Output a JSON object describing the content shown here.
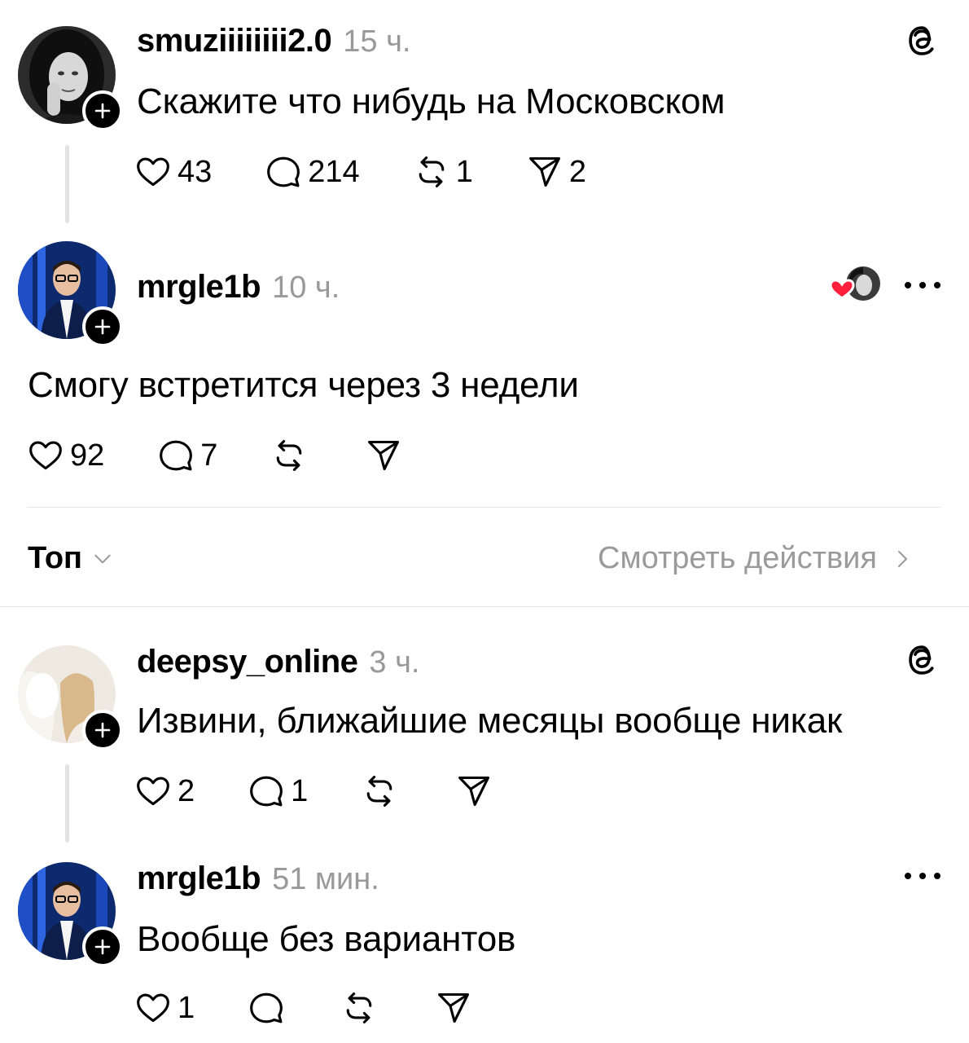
{
  "posts": [
    {
      "username": "smuziiiiiiii2.0",
      "time": "15 ч.",
      "text": "Скажите что нибудь на Московском",
      "likes": "43",
      "replies": "214",
      "reposts": "1",
      "shares": "2"
    },
    {
      "username": "mrgle1b",
      "time": "10 ч.",
      "text": "Смогу встретится через 3 недели",
      "likes": "92",
      "replies": "7"
    },
    {
      "username": "deepsy_online",
      "time": "3 ч.",
      "text": "Извини, ближайшие месяцы вообще никак",
      "likes": "2",
      "replies": "1"
    },
    {
      "username": "mrgle1b",
      "time": "51 мин.",
      "text": "Вообще без вариантов",
      "likes": "1"
    }
  ],
  "sort": {
    "label": "Топ"
  },
  "activity": {
    "label": "Смотреть действия"
  },
  "icons": {
    "like": "heart-icon",
    "reply": "comment-icon",
    "repost": "repost-icon",
    "share": "send-icon",
    "threads": "threads-logo-icon",
    "more": "more-icon",
    "follow": "plus-icon"
  },
  "colors": {
    "text": "#000000",
    "muted": "#999999",
    "heart": "#ff1f3d",
    "line": "#e3e3e3"
  }
}
